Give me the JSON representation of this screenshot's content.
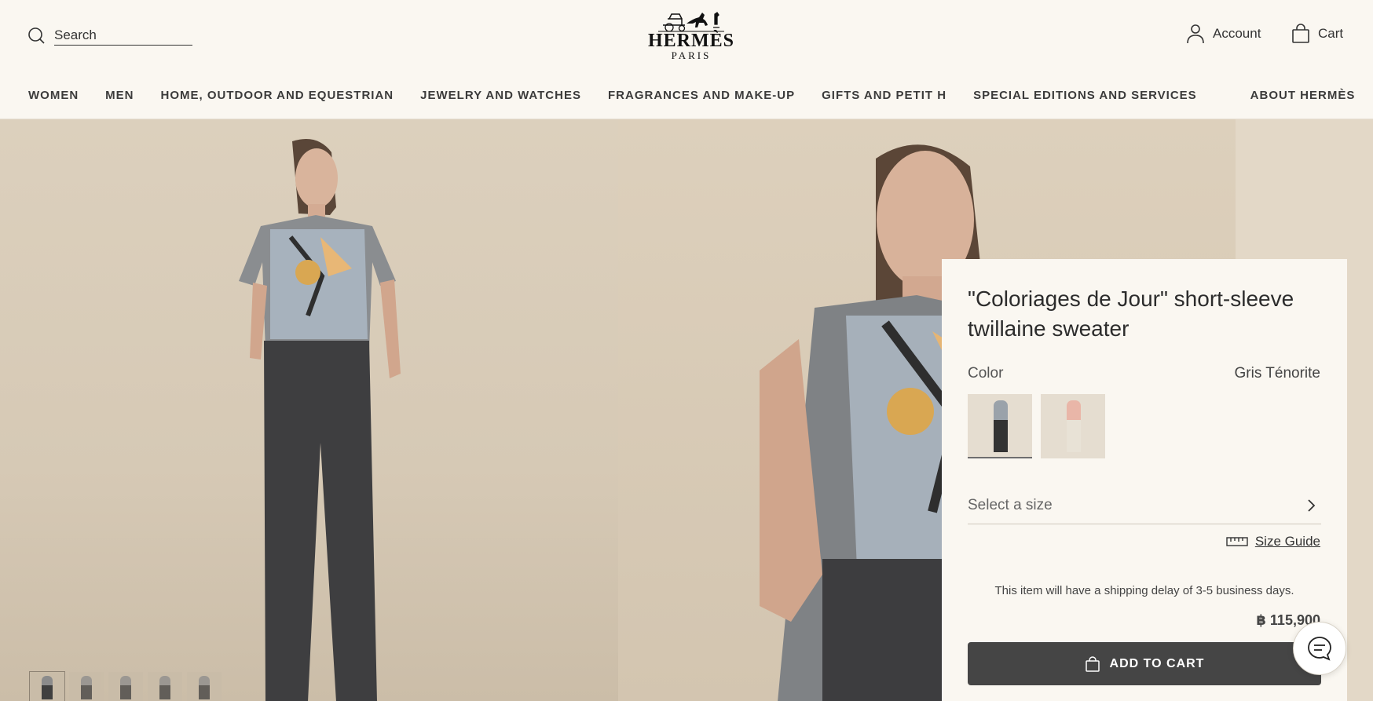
{
  "header": {
    "search": {
      "placeholder": "Search"
    },
    "logo": {
      "brand": "HERMÈS",
      "city": "PARIS"
    },
    "account_label": "Account",
    "cart_label": "Cart"
  },
  "nav": {
    "items": [
      "WOMEN",
      "MEN",
      "HOME, OUTDOOR AND EQUESTRIAN",
      "JEWELRY AND WATCHES",
      "FRAGRANCES AND MAKE-UP",
      "GIFTS AND PETIT H",
      "SPECIAL EDITIONS AND SERVICES",
      "ABOUT HERMÈS"
    ]
  },
  "gallery": {
    "thumbnail_count": 5,
    "active_thumbnail": 1
  },
  "product": {
    "title": "\"Coloriages de Jour\" short-sleeve twillaine sweater",
    "color_label": "Color",
    "color_value": "Gris Ténorite",
    "swatches": [
      {
        "color": "#9aa2aa",
        "selected": true
      },
      {
        "color": "#e9b6a8",
        "selected": false
      }
    ],
    "size_placeholder": "Select a size",
    "size_guide_label": "Size Guide",
    "shipping_note": "This item will have a shipping delay of 3-5 business days.",
    "price": "฿ 115,900",
    "add_to_cart_label": "ADD TO CART"
  },
  "colors": {
    "background": "#faf7f1",
    "button": "#454545",
    "text": "#333333"
  }
}
